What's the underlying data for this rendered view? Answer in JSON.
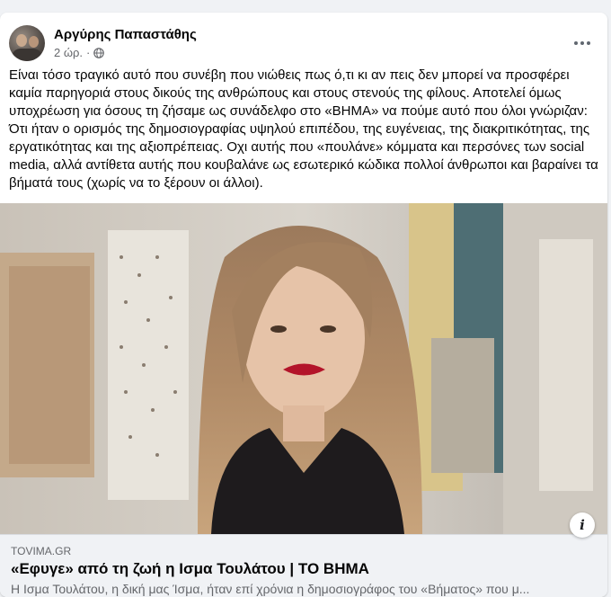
{
  "post": {
    "author": "Αργύρης Παπαστάθης",
    "time": "2 ώρ.",
    "separator": "·",
    "privacy_icon": "globe-icon",
    "more_icon": "more-horizontal-icon",
    "text": "Είναι τόσο τραγικό αυτό που συνέβη που νιώθεις πως ό,τι κι αν πεις δεν μπορεί να προσφέρει καμία παρηγοριά στους δικούς της ανθρώπους και στους στενούς της φίλους. Αποτελεί όμως υποχρέωση για όσους τη ζήσαμε ως συνάδελφο στο «ΒΗΜΑ» να πούμε αυτό που όλοι γνώριζαν: Ότι ήταν ο ορισμός της δημοσιογραφίας υψηλού επιπέδου, της ευγένειας, της διακριτικότητας, της εργατικότητας και της αξιοπρέπειας. Οχι αυτής που «πουλάνε» κόμματα και περσόνες των social media, αλλά αντίθετα αυτής που κουβαλάνε ως εσωτερικό κώδικα πολλοί άνθρωποι και βαραίνει τα βήματά τους (χωρίς να το ξέρουν οι άλλοι)."
  },
  "link": {
    "domain": "TOVIMA.GR",
    "title": "«Εφυγε» από τη ζωή η Ισμα Τουλάτου | ΤΟ ΒΗΜΑ",
    "description": "Η Ισμα Τουλάτου, η δική μας Ίσμα, ήταν επί χρόνια η δημοσιογράφος του «Βήματος» που μ...",
    "info_button": "i",
    "info_icon": "info-icon"
  },
  "colors": {
    "background": "#f0f2f5",
    "card": "#ffffff",
    "secondary_text": "#65676b"
  }
}
